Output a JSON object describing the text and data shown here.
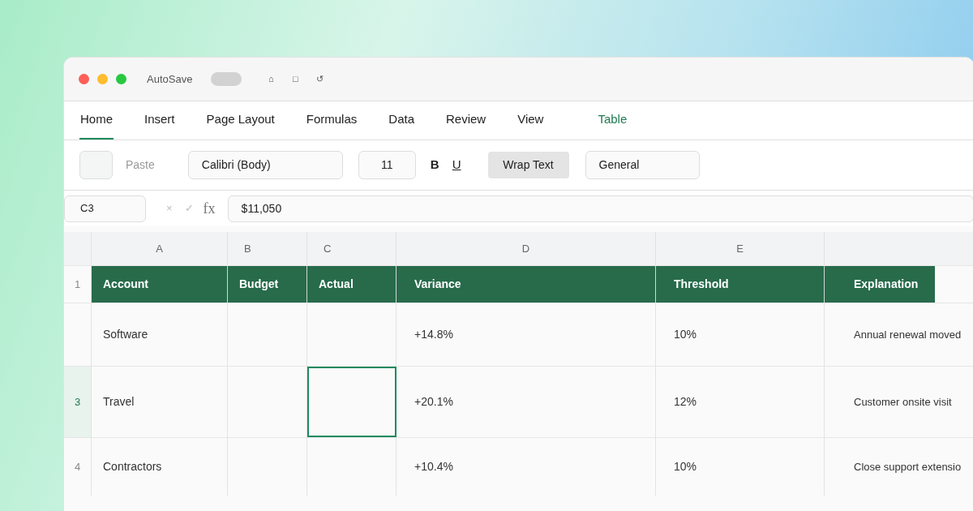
{
  "title_bar": {
    "autosave_label": "AutoSave",
    "autosave_on": false,
    "quick_icons": [
      "⌂",
      "□",
      "↺"
    ]
  },
  "tabs": [
    {
      "label": "Home",
      "selected": true,
      "contextual": false
    },
    {
      "label": "Insert",
      "selected": false,
      "contextual": false
    },
    {
      "label": "Page Layout",
      "selected": false,
      "contextual": false
    },
    {
      "label": "Formulas",
      "selected": false,
      "contextual": false
    },
    {
      "label": "Data",
      "selected": false,
      "contextual": false
    },
    {
      "label": "Review",
      "selected": false,
      "contextual": false
    },
    {
      "label": "View",
      "selected": false,
      "contextual": false
    },
    {
      "label": "Table",
      "selected": false,
      "contextual": true
    }
  ],
  "toolbar": {
    "paste_label": "Paste",
    "paste_disabled": true,
    "font": "Calibri (Body)",
    "size": "11",
    "bold": "B",
    "underline": "U",
    "wrap_text": {
      "label": "Wrap Text",
      "on": true
    },
    "number_format": "General"
  },
  "formula_bar": {
    "name_box": "C3",
    "cancel": "×",
    "enter": "✓",
    "fx": "fx",
    "value": "$11,050"
  },
  "sheet": {
    "columns": [
      "A",
      "B",
      "C",
      "D",
      "E"
    ],
    "rows": [
      {
        "number": "1",
        "selected": false,
        "kind": "header",
        "cells": [
          {
            "text": "Account",
            "selected": false
          },
          {
            "text": "Budget",
            "selected": false
          },
          {
            "text": "Actual",
            "selected": false
          },
          {
            "text": "Variance",
            "selected": false
          },
          {
            "text": "Threshold",
            "selected": false
          },
          {
            "text": "Explanation",
            "selected": false
          }
        ]
      },
      {
        "selected": false,
        "kind": "data",
        "cells": [
          {
            "text": "Software",
            "selected": false
          },
          {
            "selected": false
          },
          {
            "selected": false
          },
          {
            "text": "+14.8%",
            "selected": false
          },
          {
            "text": "10%",
            "selected": false
          },
          {
            "text": "Annual renewal moved",
            "selected": false
          }
        ]
      },
      {
        "number": "3",
        "selected": true,
        "kind": "data",
        "cells": [
          {
            "text": "Travel",
            "selected": false
          },
          {
            "selected": false
          },
          {
            "selected": true
          },
          {
            "text": "+20.1%",
            "selected": false
          },
          {
            "text": "12%",
            "selected": false
          },
          {
            "text": "Customer onsite visit",
            "selected": false
          }
        ]
      },
      {
        "number": "4",
        "selected": false,
        "kind": "data",
        "cells": [
          {
            "text": "Contractors",
            "selected": false
          },
          {
            "selected": false
          },
          {
            "selected": false
          },
          {
            "text": "+10.4%",
            "selected": false
          },
          {
            "text": "10%",
            "selected": false
          },
          {
            "text": "Close support extensio",
            "selected": false
          }
        ]
      }
    ]
  }
}
